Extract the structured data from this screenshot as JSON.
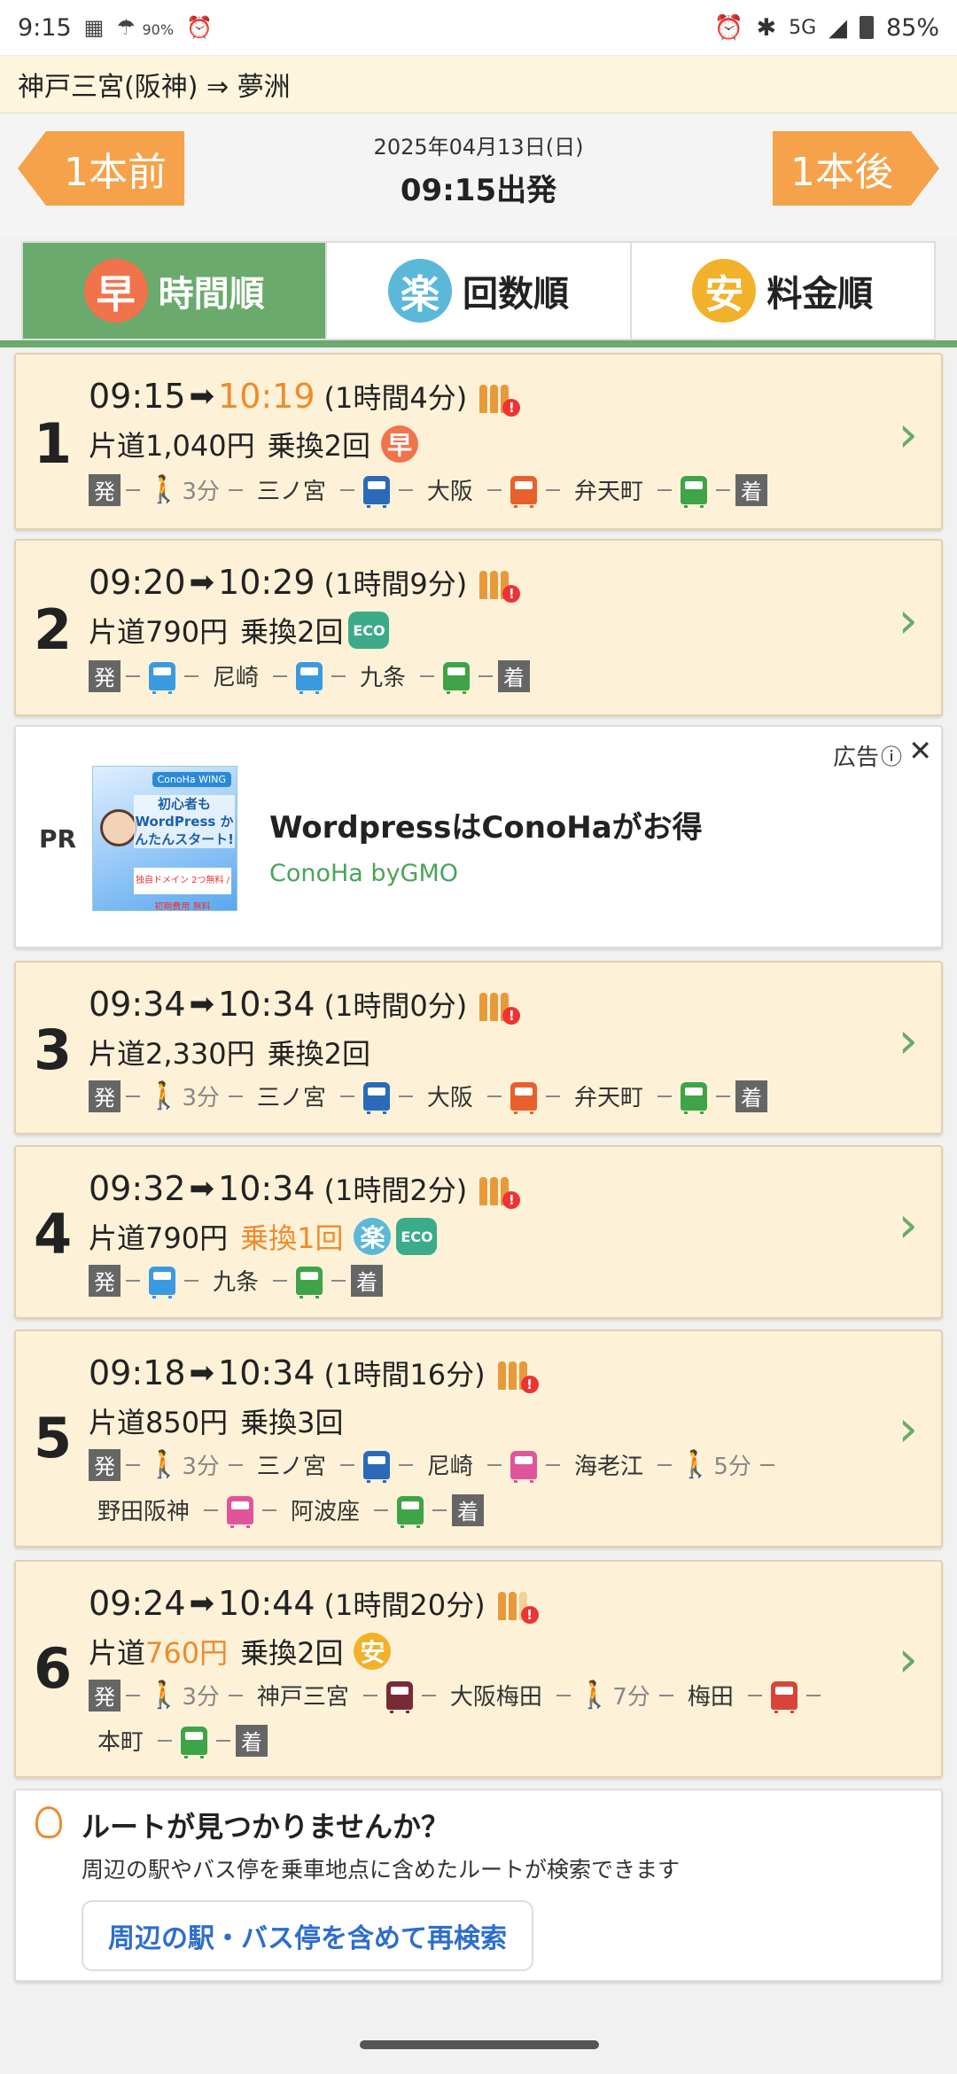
{
  "status_bar": {
    "time": "9:15",
    "weather_pct": "90%",
    "network": "5G",
    "battery": "85%"
  },
  "route": {
    "title": "神戸三宮(阪神) ⇒ 夢洲"
  },
  "date_bar": {
    "prev_label": "1本前",
    "next_label": "1本後",
    "date": "2025年04月13日(日)",
    "departure": "09:15出発"
  },
  "tabs": [
    {
      "badge": "早",
      "label": "時間順",
      "badge_color": "#f0734c",
      "active": true
    },
    {
      "badge": "楽",
      "label": "回数順",
      "badge_color": "#5bb8d8",
      "active": false
    },
    {
      "badge": "安",
      "label": "料金順",
      "badge_color": "#f2b12a",
      "active": false
    }
  ],
  "routes": [
    {
      "number": "1",
      "depart": "09:15",
      "arrive": "10:19",
      "duration": "(1時間4分)",
      "fare": "片道1,040円",
      "transfers": "乗換2回",
      "badge": "早",
      "segments": [
        {
          "t": "box",
          "v": "発"
        },
        {
          "t": "walk",
          "v": "3分"
        },
        {
          "t": "stn",
          "v": "三ノ宮"
        },
        {
          "t": "train",
          "c": "#2a6ab8"
        },
        {
          "t": "stn",
          "v": "大阪"
        },
        {
          "t": "train",
          "c": "#e8602c"
        },
        {
          "t": "stn",
          "v": "弁天町"
        },
        {
          "t": "train",
          "c": "#3ea447"
        },
        {
          "t": "box",
          "v": "着"
        }
      ]
    },
    {
      "number": "2",
      "depart": "09:20",
      "arrive": "10:29",
      "duration": "(1時間9分)",
      "fare": "片道790円",
      "transfers": "乗換2回",
      "badge": "ECO",
      "segments": [
        {
          "t": "box",
          "v": "発"
        },
        {
          "t": "train",
          "c": "#3a9ae0"
        },
        {
          "t": "stn",
          "v": "尼崎"
        },
        {
          "t": "train",
          "c": "#3a9ae0"
        },
        {
          "t": "stn",
          "v": "九条"
        },
        {
          "t": "train",
          "c": "#3ea447"
        },
        {
          "t": "box",
          "v": "着"
        }
      ]
    },
    {
      "number": "3",
      "depart": "09:34",
      "arrive": "10:34",
      "duration": "(1時間0分)",
      "fare": "片道2,330円",
      "transfers": "乗換2回",
      "segments": [
        {
          "t": "box",
          "v": "発"
        },
        {
          "t": "walk",
          "v": "3分"
        },
        {
          "t": "stn",
          "v": "三ノ宮"
        },
        {
          "t": "train",
          "c": "#2a6ab8"
        },
        {
          "t": "stn",
          "v": "大阪"
        },
        {
          "t": "train",
          "c": "#e8602c"
        },
        {
          "t": "stn",
          "v": "弁天町"
        },
        {
          "t": "train",
          "c": "#3ea447"
        },
        {
          "t": "box",
          "v": "着"
        }
      ]
    },
    {
      "number": "4",
      "depart": "09:32",
      "arrive": "10:34",
      "duration": "(1時間2分)",
      "fare": "片道790円",
      "transfers": "乗換1回",
      "badge": "楽",
      "segments": [
        {
          "t": "box",
          "v": "発"
        },
        {
          "t": "train",
          "c": "#3a9ae0"
        },
        {
          "t": "stn",
          "v": "九条"
        },
        {
          "t": "train",
          "c": "#3ea447"
        },
        {
          "t": "box",
          "v": "着"
        }
      ]
    },
    {
      "number": "5",
      "depart": "09:18",
      "arrive": "10:34",
      "duration": "(1時間16分)",
      "fare": "片道850円",
      "transfers": "乗換3回",
      "segments": [
        {
          "t": "box",
          "v": "発"
        },
        {
          "t": "walk",
          "v": "3分"
        },
        {
          "t": "stn",
          "v": "三ノ宮"
        },
        {
          "t": "train",
          "c": "#2a6ab8"
        },
        {
          "t": "stn",
          "v": "尼崎"
        },
        {
          "t": "train",
          "c": "#e0559a"
        },
        {
          "t": "stn",
          "v": "海老江"
        },
        {
          "t": "walk",
          "v": "5分"
        },
        {
          "t": "stn",
          "v": "野田阪神"
        },
        {
          "t": "train",
          "c": "#e0559a"
        },
        {
          "t": "stn",
          "v": "阿波座"
        },
        {
          "t": "train",
          "c": "#3ea447"
        },
        {
          "t": "box",
          "v": "着"
        }
      ]
    },
    {
      "number": "6",
      "depart": "09:24",
      "arrive": "10:44",
      "duration": "(1時間20分)",
      "fare": "片道760円",
      "transfers": "乗換2回",
      "badge": "安",
      "segments": [
        {
          "t": "box",
          "v": "発"
        },
        {
          "t": "walk",
          "v": "3分"
        },
        {
          "t": "stn",
          "v": "神戸三宮"
        },
        {
          "t": "train",
          "c": "#7a2a35"
        },
        {
          "t": "stn",
          "v": "大阪梅田"
        },
        {
          "t": "walk",
          "v": "7分"
        },
        {
          "t": "stn",
          "v": "梅田"
        },
        {
          "t": "train",
          "c": "#d8443a"
        },
        {
          "t": "stn",
          "v": "本町"
        },
        {
          "t": "train",
          "c": "#3ea447"
        },
        {
          "t": "box",
          "v": "着"
        }
      ]
    }
  ],
  "ad": {
    "pr": "PR",
    "label": "広告",
    "title": "WordpressはConoHaがお得",
    "advertiser": "ConoHa byGMO",
    "thumb_logo": "ConoHa WING",
    "thumb_text": "初心者も WordPress かんたんスタート!",
    "thumb_foot": "独自ドメイン 2つ無料 / 初期費用 無料"
  },
  "not_found": {
    "title": "ルートが見つかりませんか？",
    "text": "周辺の駅やバス停を乗車地点に含めたルートが検索できます",
    "button": "周辺の駅・バス停を含めて再検索"
  }
}
